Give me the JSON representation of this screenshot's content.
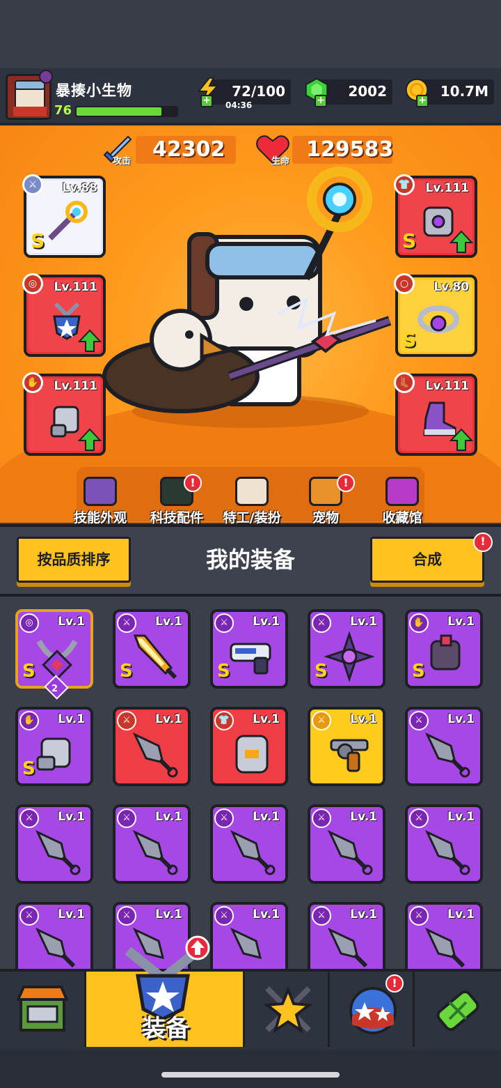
{
  "player": {
    "name": "暴揍小生物",
    "level": "76",
    "xp_fraction": 0.85
  },
  "resources": {
    "energy": "72/100",
    "energy_timer": "04:36",
    "gems": "2002",
    "coins": "10.7M"
  },
  "stats": {
    "attack_label": "攻击",
    "attack": "42302",
    "hp_label": "生命",
    "hp": "129583"
  },
  "equipped": {
    "weapon": {
      "level": "Lv.88",
      "grade": "S"
    },
    "armor": {
      "level": "Lv.111",
      "grade": "S"
    },
    "necklace": {
      "level": "Lv.111"
    },
    "ring": {
      "level": "Lv.80",
      "grade": "S"
    },
    "glove": {
      "level": "Lv.111"
    },
    "boots": {
      "level": "Lv.111"
    }
  },
  "menu": {
    "skill_skin": "技能外观",
    "tech": "科技配件",
    "agent": "特工/装扮",
    "pet": "宠物",
    "collection": "收藏馆"
  },
  "inventory": {
    "sort_button": "按品质排序",
    "title": "我的装备",
    "merge_button": "合成",
    "alert": "!",
    "items": [
      {
        "level": "Lv.1",
        "grade": "S",
        "count": "2"
      },
      {
        "level": "Lv.1",
        "grade": "S"
      },
      {
        "level": "Lv.1",
        "grade": "S"
      },
      {
        "level": "Lv.1",
        "grade": "S"
      },
      {
        "level": "Lv.1",
        "grade": "S"
      },
      {
        "level": "Lv.1",
        "grade": "S"
      },
      {
        "level": "Lv.1"
      },
      {
        "level": "Lv.1"
      },
      {
        "level": "Lv.1"
      },
      {
        "level": "Lv.1"
      },
      {
        "level": "Lv.1"
      },
      {
        "level": "Lv.1"
      },
      {
        "level": "Lv.1"
      },
      {
        "level": "Lv.1"
      },
      {
        "level": "Lv.1"
      },
      {
        "level": "Lv.1"
      },
      {
        "level": "Lv.1"
      },
      {
        "level": "Lv.1"
      },
      {
        "level": "Lv.1"
      },
      {
        "level": "Lv.1"
      }
    ]
  },
  "tabs": {
    "equipment": "装备"
  },
  "colors": {
    "orange": "#f78614",
    "purple_rarity": "#a748e6",
    "red_rarity": "#ee3d45",
    "gold_rarity": "#ffcc1e",
    "accent_yellow": "#ffc21e"
  }
}
